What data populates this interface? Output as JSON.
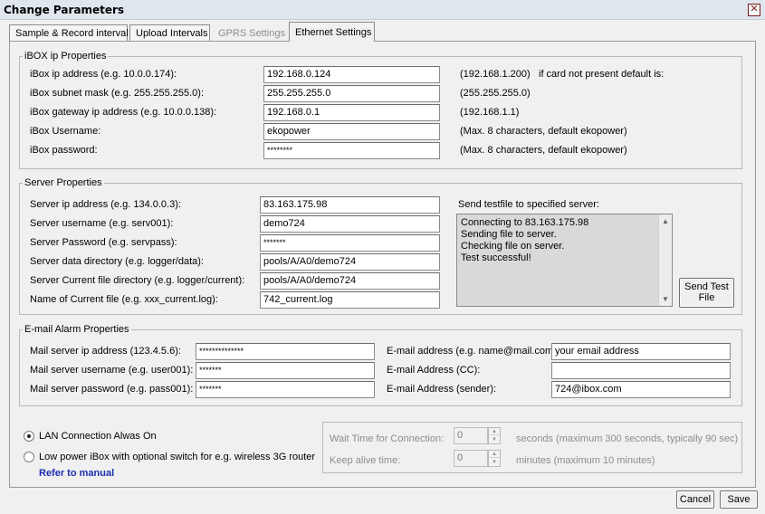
{
  "window": {
    "title": "Change Parameters",
    "close_symbol": "✕"
  },
  "tabs": [
    {
      "label": "Sample & Record interval",
      "state": "normal"
    },
    {
      "label": "Upload Intervals",
      "state": "normal"
    },
    {
      "label": "GPRS Settings",
      "state": "disabled"
    },
    {
      "label": "Ethernet Settings",
      "state": "active"
    }
  ],
  "ibox": {
    "legend": "iBOX ip Properties",
    "ip_label": "iBox ip address (e.g. 10.0.0.174):",
    "ip_value": "192.168.0.124",
    "ip_default": "(192.168.1.200)",
    "default_note": "if card not present default is:",
    "subnet_label": "iBox subnet mask (e.g. 255.255.255.0):",
    "subnet_value": "255.255.255.0",
    "subnet_default": "(255.255.255.0)",
    "gateway_label": "iBox gateway ip address (e.g. 10.0.0.138):",
    "gateway_value": "192.168.0.1",
    "gateway_default": "(192.168.1.1)",
    "username_label": "iBox Username:",
    "username_value": "ekopower",
    "username_note": "(Max. 8 characters, default ekopower)",
    "password_label": "iBox password:",
    "password_value": "********",
    "password_note": "(Max. 8 characters, default ekopower)"
  },
  "server": {
    "legend": "Server Properties",
    "ip_label": "Server ip address (e.g. 134.0.0.3):",
    "ip_value": "83.163.175.98",
    "username_label": "Server username (e.g. serv001):",
    "username_value": "demo724",
    "password_label": "Server Password (e.g. servpass):",
    "password_value": "*******",
    "data_dir_label": "Server data directory (e.g. logger/data):",
    "data_dir_value": "pools/A/A0/demo724",
    "current_dir_label": "Server Current file directory (e.g. logger/current):",
    "current_dir_value": "pools/A/A0/demo724",
    "current_file_label": "Name of Current file (e.g. xxx_current.log):",
    "current_file_value": "742_current.log",
    "testfile_label": "Send testfile to specified server:",
    "log_lines": [
      "Connecting to 83.163.175.98",
      "Sending file to server.",
      "Checking file on server.",
      "Test successful!"
    ],
    "send_test_label_1": "Send Test",
    "send_test_label_2": "File"
  },
  "email": {
    "legend": "E-mail Alarm Properties",
    "mail_ip_label": "Mail server ip address (123.4.5.6):",
    "mail_ip_value": "**************",
    "mail_user_label": "Mail server username (e.g. user001):",
    "mail_user_value": "*******",
    "mail_pass_label": "Mail server password (e.g. pass001):",
    "mail_pass_value": "*******",
    "address_label": "E-mail address (e.g. name@mail.com):",
    "address_value": "your email address",
    "cc_label": "E-mail Address (CC):",
    "cc_value": "",
    "sender_label": "E-mail Address (sender):",
    "sender_value": "724@ibox.com"
  },
  "connection": {
    "lan_label": "LAN Connection Alwas On",
    "lowpower_label": "Low power iBox with optional switch for e.g. wireless 3G router",
    "manual_link": "Refer to manual",
    "wait_label": "Wait Time for Connection:",
    "wait_value": "0",
    "wait_note": "seconds (maximum 300 seconds, typically 90 sec)",
    "keepalive_label": "Keep alive time:",
    "keepalive_value": "0",
    "keepalive_note": "minutes (maximum 10 minutes)"
  },
  "footer": {
    "cancel_label": "Cancel",
    "save_label": "Save"
  }
}
